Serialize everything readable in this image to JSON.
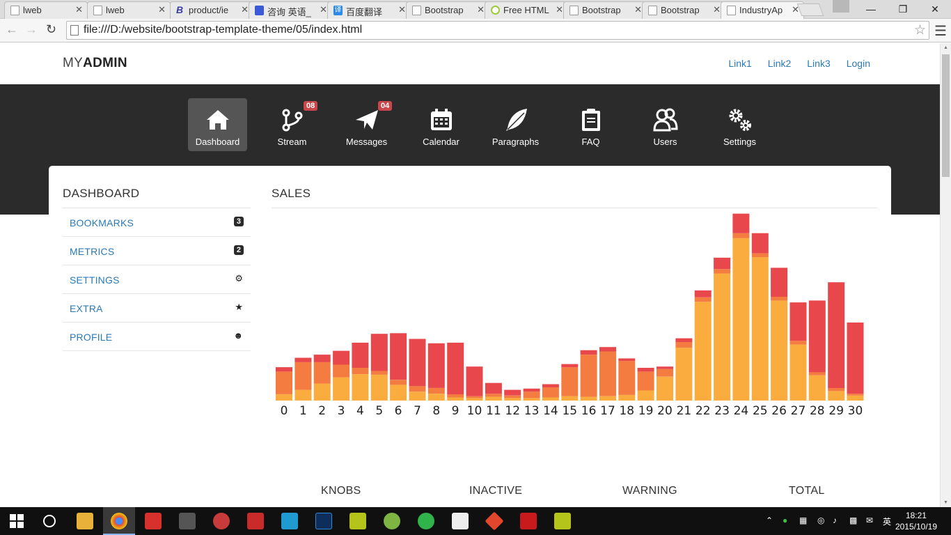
{
  "browser": {
    "tabs": [
      {
        "label": "lweb",
        "icon": "page-icon"
      },
      {
        "label": "lweb",
        "icon": "page-icon"
      },
      {
        "label": "product/ie",
        "icon": "bootstrap-b-icon"
      },
      {
        "label": "咨询 英语_",
        "icon": "paw-icon"
      },
      {
        "label": "百度翻译",
        "icon": "translate-icon"
      },
      {
        "label": "Bootstrap",
        "icon": "page-icon"
      },
      {
        "label": "Free HTML",
        "icon": "swirl-icon"
      },
      {
        "label": "Bootstrap",
        "icon": "page-icon"
      },
      {
        "label": "Bootstrap",
        "icon": "page-icon"
      },
      {
        "label": "IndustryAp",
        "icon": "page-icon"
      }
    ],
    "active_tab": 9,
    "url": "file:///D:/website/bootstrap-template-theme/05/index.html"
  },
  "site": {
    "brand_light": "MY",
    "brand_bold": "ADMIN",
    "top_links": [
      "Link1",
      "Link2",
      "Link3",
      "Login"
    ]
  },
  "iconnav": {
    "items": [
      {
        "label": "Dashboard",
        "icon": "home-icon",
        "active": true
      },
      {
        "label": "Stream",
        "icon": "branch-icon",
        "badge": "08"
      },
      {
        "label": "Messages",
        "icon": "paper-plane-icon",
        "badge": "04"
      },
      {
        "label": "Calendar",
        "icon": "calendar-icon"
      },
      {
        "label": "Paragraphs",
        "icon": "feather-icon"
      },
      {
        "label": "FAQ",
        "icon": "clipboard-icon"
      },
      {
        "label": "Users",
        "icon": "users-icon"
      },
      {
        "label": "Settings",
        "icon": "gears-icon"
      }
    ]
  },
  "sidebar": {
    "title": "DASHBOARD",
    "items": [
      {
        "label": "BOOKMARKS",
        "badge": "3"
      },
      {
        "label": "METRICS",
        "badge": "2"
      },
      {
        "label": "SETTINGS",
        "icon": "gear-icon"
      },
      {
        "label": "EXTRA",
        "icon": "star-icon"
      },
      {
        "label": "PROFILE",
        "icon": "user-icon"
      }
    ]
  },
  "sales": {
    "title": "SALES"
  },
  "stats": [
    "KNOBS",
    "INACTIVE",
    "WARNING",
    "TOTAL"
  ],
  "colors": {
    "series_top": "#e8474b",
    "series_mid": "#f47c40",
    "series_base": "#fbac3f",
    "link": "#2a79b8",
    "navbar": "#2b2b2b"
  },
  "chart_data": {
    "type": "bar",
    "stacked": true,
    "categories": [
      "0",
      "1",
      "2",
      "3",
      "4",
      "5",
      "6",
      "7",
      "8",
      "9",
      "10",
      "11",
      "12",
      "13",
      "14",
      "15",
      "16",
      "17",
      "18",
      "19",
      "20",
      "21",
      "22",
      "23",
      "24",
      "25",
      "26",
      "27",
      "28",
      "29",
      "30"
    ],
    "series": [
      {
        "values": [
          10,
          17,
          27,
          37,
          42,
          41,
          25,
          14,
          11,
          5,
          4,
          6,
          4,
          4,
          5,
          7,
          6,
          7,
          9,
          16,
          38,
          84,
          157,
          202,
          258,
          228,
          159,
          89,
          40,
          15,
          8
        ]
      },
      {
        "values": [
          36,
          44,
          34,
          20,
          10,
          6,
          8,
          9,
          9,
          5,
          3,
          5,
          4,
          10,
          16,
          46,
          67,
          71,
          54,
          30,
          12,
          9,
          7,
          7,
          8,
          6,
          6,
          6,
          5,
          5,
          3
        ]
      },
      {
        "values": [
          7,
          7,
          12,
          22,
          40,
          59,
          74,
          75,
          71,
          82,
          47,
          17,
          9,
          5,
          5,
          5,
          7,
          7,
          4,
          6,
          4,
          6,
          11,
          18,
          31,
          32,
          46,
          61,
          114,
          168,
          113
        ]
      }
    ],
    "ylim": [
      0,
      300
    ],
    "grid": false,
    "legend": "none"
  }
}
